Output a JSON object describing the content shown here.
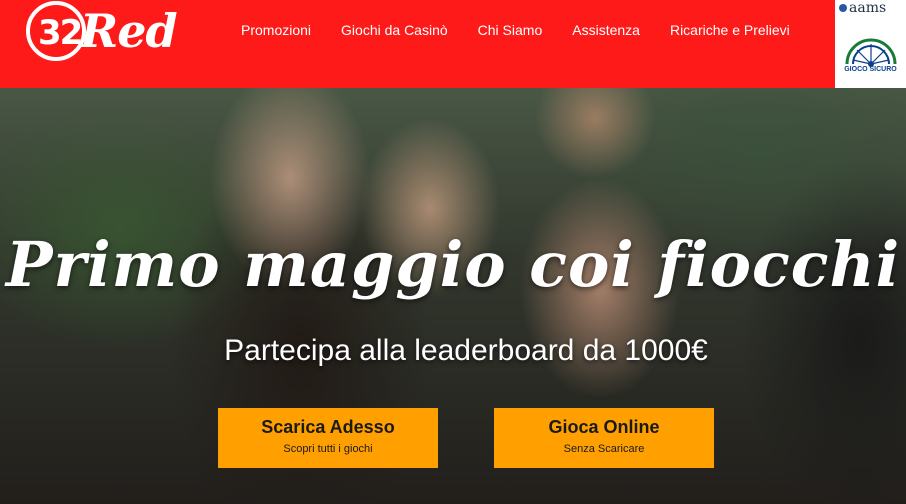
{
  "brand": {
    "logo_number": "32",
    "logo_word": "Red"
  },
  "nav": {
    "items": [
      {
        "label": "Promozioni"
      },
      {
        "label": "Giochi da Casinò"
      },
      {
        "label": "Chi Siamo"
      },
      {
        "label": "Assistenza"
      },
      {
        "label": "Ricariche e Prelievi"
      }
    ]
  },
  "badge": {
    "aams_label": "aams",
    "gioco_sicuro_label": "GIOCO SICURO"
  },
  "hero": {
    "headline": "Primo maggio coi fiocchi",
    "subline": "Partecipa alla leaderboard da 1000€"
  },
  "cta": {
    "download": {
      "title": "Scarica Adesso",
      "subtitle": "Scopri tutti i giochi"
    },
    "online": {
      "title": "Gioca Online",
      "subtitle": "Senza Scaricare"
    }
  },
  "colors": {
    "header_red": "#ff1a1a",
    "cta_orange": "#ffa000"
  }
}
